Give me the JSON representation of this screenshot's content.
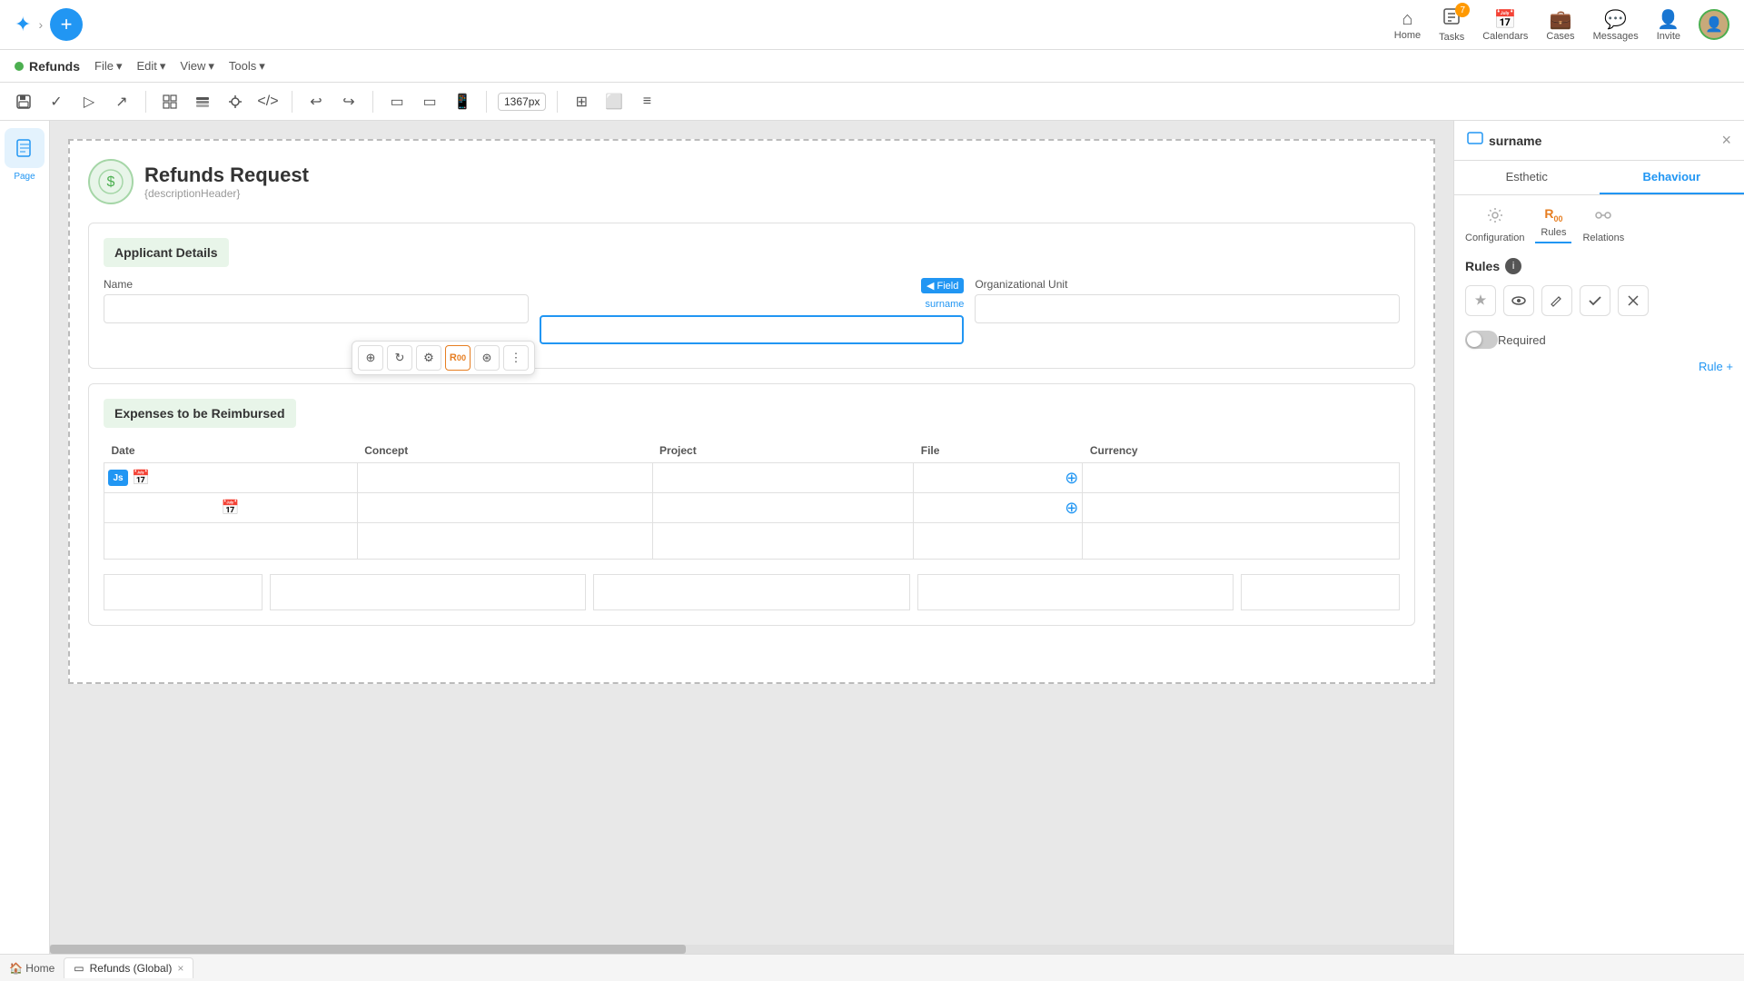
{
  "topNav": {
    "logoIcon": "✦",
    "breadcrumbArrow": "›",
    "addBtnLabel": "+",
    "navItems": [
      {
        "id": "home",
        "label": "Home",
        "icon": "⌂",
        "badge": null
      },
      {
        "id": "tasks",
        "label": "Tasks",
        "icon": "✓",
        "badge": "7"
      },
      {
        "id": "calendars",
        "label": "Calendars",
        "icon": "📅",
        "badge": null
      },
      {
        "id": "cases",
        "label": "Cases",
        "icon": "💼",
        "badge": null
      },
      {
        "id": "messages",
        "label": "Messages",
        "icon": "💬",
        "badge": null
      },
      {
        "id": "invite",
        "label": "Invite",
        "icon": "👤",
        "badge": null
      }
    ]
  },
  "menuBar": {
    "appOnline": true,
    "appName": "Refunds",
    "menuItems": [
      "File",
      "Edit",
      "View",
      "Tools"
    ]
  },
  "toolbar": {
    "buttons": [
      "⊞",
      "⊟",
      "≡",
      "⊕",
      "</>"
    ],
    "undoIcon": "↩",
    "redoIcon": "↪",
    "screenIcons": [
      "▭",
      "▭",
      "📱"
    ],
    "pxValue": "1367px",
    "layoutIcons": [
      "⊞",
      "⬜",
      "≡"
    ]
  },
  "sidebar": {
    "items": [
      {
        "id": "page",
        "icon": "📄",
        "label": "Page",
        "active": true
      }
    ]
  },
  "form": {
    "logoIcon": "$",
    "title": "Refunds Request",
    "subtitle": "{descriptionHeader}",
    "sections": [
      {
        "id": "applicant",
        "header": "Applicant Details",
        "fields": [
          {
            "id": "name",
            "label": "Name",
            "selected": false
          },
          {
            "id": "surname",
            "label": "Surname",
            "selected": true
          },
          {
            "id": "orgUnit",
            "label": "Organizational Unit",
            "selected": false
          }
        ]
      },
      {
        "id": "expenses",
        "header": "Expenses to be Reimbursed",
        "columns": [
          "Date",
          "Concept",
          "Project",
          "File",
          "Currency"
        ]
      }
    ]
  },
  "floatingToolbar": {
    "icons": [
      "⊕",
      "↻",
      "⚙",
      "R₀₀",
      "⊛",
      "⋮"
    ],
    "activeIndex": 3,
    "fieldTag": "◀ Field",
    "fieldLabel": "surname"
  },
  "rightPanel": {
    "title": "surname",
    "titleIcon": "▭",
    "closeIcon": "×",
    "tabs": [
      "Esthetic",
      "Behaviour"
    ],
    "activeTab": "Behaviour",
    "subTabs": [
      {
        "id": "configuration",
        "icon": "⚙",
        "label": "Configuration"
      },
      {
        "id": "rules",
        "icon": "R₀₀",
        "label": "Rules",
        "active": true
      },
      {
        "id": "relations",
        "icon": "⊛",
        "label": "Relations"
      }
    ],
    "rulesSection": {
      "label": "Rules",
      "infoBadge": "i",
      "ruleIcons": [
        "✦",
        "👁",
        "✎",
        "✓",
        "✂"
      ],
      "requiredLabel": "Required",
      "toggleOn": false,
      "ruleAddLabel": "Rule +"
    }
  },
  "statusBar": {
    "homeLabel": "🏠 Home",
    "tabs": [
      {
        "id": "refunds",
        "icon": "▭",
        "label": "Refunds (Global)",
        "closable": true
      }
    ]
  }
}
